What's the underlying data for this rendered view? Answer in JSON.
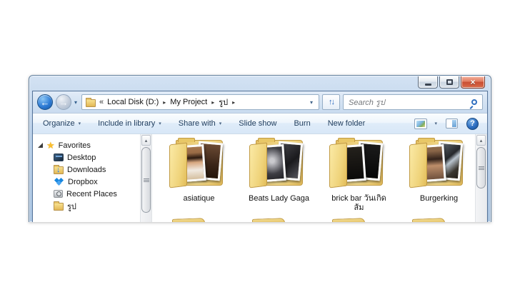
{
  "window": {
    "app": "Windows Explorer"
  },
  "icons": {
    "back": "←",
    "forward": "→",
    "dropdown": "▾",
    "scroll_up": "▴",
    "close": "×",
    "star": "★",
    "refresh": "↑↓",
    "help": "?",
    "breadcrumb_separator": "▸",
    "breadcrumb_overflow": "«"
  },
  "navigation": {
    "breadcrumb": {
      "overflow": "«",
      "items": [
        "Local Disk (D:)",
        "My Project",
        "รูป"
      ],
      "separator": "▸"
    },
    "search": {
      "placeholder": "Search รูป"
    }
  },
  "toolbar": {
    "items": [
      {
        "label": "Organize",
        "dropdown": true
      },
      {
        "label": "Include in library",
        "dropdown": true
      },
      {
        "label": "Share with",
        "dropdown": true
      },
      {
        "label": "Slide show",
        "dropdown": false
      },
      {
        "label": "Burn",
        "dropdown": false
      },
      {
        "label": "New folder",
        "dropdown": false
      }
    ]
  },
  "sidebar": {
    "favorites": {
      "label": "Favorites",
      "expanded": true
    },
    "items": [
      {
        "label": "Desktop"
      },
      {
        "label": "Downloads"
      },
      {
        "label": "Dropbox"
      },
      {
        "label": "Recent Places"
      },
      {
        "label": "รูป"
      }
    ]
  },
  "content": {
    "folders": [
      {
        "label": "asiatique",
        "label2": "",
        "photo_back": "linear-gradient(180deg,#6b4a33 0%,#3a2518 60%,#241509 100%)",
        "photo_front": "linear-gradient(180deg,#a5754e 0%,#9a6c46 18%,#2b1a10 34%,#d7a77f 48%,#f0e9e0 72%,#d5bf9f 100%)"
      },
      {
        "label": "Beats Lady Gaga",
        "label2": "",
        "photo_back": "linear-gradient(135deg,#45454a 0%,#1a1a1d 55%,#55555b 100%)",
        "photo_front": "radial-gradient(circle at 45% 42%,#cacace 10%,#8f8f95 32%,#3e3e44 62%,#212125 100%)"
      },
      {
        "label": "brick bar วันเกิด",
        "label2": "ส้ม",
        "photo_back": "linear-gradient(180deg,#1b1b1b 0%,#060606 100%)",
        "photo_front": "linear-gradient(180deg,#24211c 0%,#0b0a09 100%)"
      },
      {
        "label": "Burgerking",
        "label2": "",
        "photo_back": "linear-gradient(135deg,#565c63 8%,#25282c 42%,#b9c4ce 54%,#3a362f 78%,#241f1a 100%)",
        "photo_front": "linear-gradient(180deg,#8a6648 12%,#33231b 38%,#bd8e6a 58%,#70513d 100%)"
      }
    ]
  },
  "colors": {
    "aero_glass": "#b7cee7",
    "close_red": "#c94f34",
    "folder_yellow": "#eecb6a",
    "accent_blue": "#2f6fc0",
    "toolbar_text": "#1e3c5c"
  }
}
